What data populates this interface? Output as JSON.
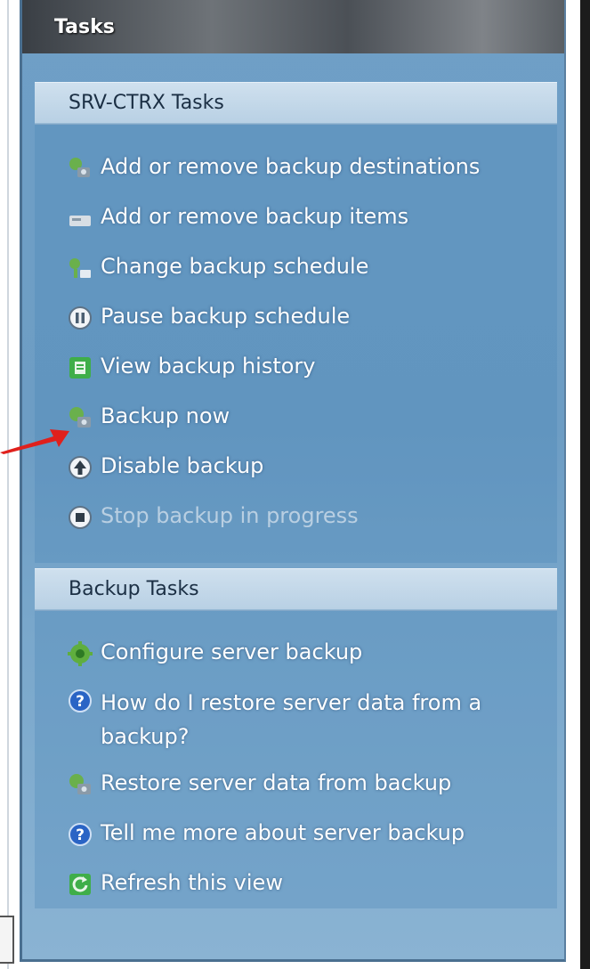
{
  "panel": {
    "title": "Tasks"
  },
  "sections": [
    {
      "title": "SRV-CTRX Tasks",
      "items": [
        {
          "label": "Add or remove backup destinations",
          "icon": "backup-destinations-icon",
          "enabled": true
        },
        {
          "label": "Add or remove backup items",
          "icon": "backup-items-icon",
          "enabled": true
        },
        {
          "label": "Change backup schedule",
          "icon": "schedule-icon",
          "enabled": true
        },
        {
          "label": "Pause backup schedule",
          "icon": "pause-icon",
          "enabled": true
        },
        {
          "label": "View backup history",
          "icon": "history-icon",
          "enabled": true
        },
        {
          "label": "Backup now",
          "icon": "backup-now-icon",
          "enabled": true
        },
        {
          "label": "Disable backup",
          "icon": "disable-icon",
          "enabled": true
        },
        {
          "label": "Stop backup in progress",
          "icon": "stop-icon",
          "enabled": false
        }
      ]
    },
    {
      "title": "Backup Tasks",
      "items": [
        {
          "label": "Configure server backup",
          "icon": "configure-icon",
          "enabled": true
        },
        {
          "label": "How do I restore server data from a backup?",
          "icon": "help-icon",
          "enabled": true
        },
        {
          "label": "Restore server data from backup",
          "icon": "restore-icon",
          "enabled": true
        },
        {
          "label": "Tell me more about server backup",
          "icon": "help-icon",
          "enabled": true
        },
        {
          "label": "Refresh this view",
          "icon": "refresh-icon",
          "enabled": true
        }
      ]
    }
  ],
  "colors": {
    "panel_bg": "#6f9fc6",
    "header_bg": "#4b5056",
    "link_text": "#ffffff",
    "disabled_text": "#b9cfe2",
    "arrow": "#e0201c"
  }
}
